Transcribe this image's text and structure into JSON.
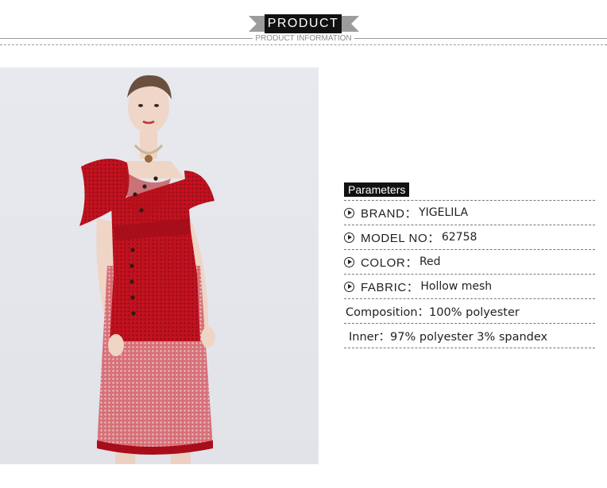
{
  "header": {
    "title": "PRODUCT",
    "subtitle": "PRODUCT INFORMATION"
  },
  "photo": {
    "description_icon": "dress-photo",
    "dress_color": "#c1121f",
    "background_color": "#e4e6eb"
  },
  "parameters": {
    "title": "Parameters",
    "rows": [
      {
        "icon": "arrow-circle-icon",
        "label": "BRAND：",
        "value": "YIGELILA"
      },
      {
        "icon": "arrow-circle-icon",
        "label": "MODEL NO：",
        "value": "62758"
      },
      {
        "icon": "arrow-circle-icon",
        "label": "COLOR：",
        "value": "Red"
      },
      {
        "icon": "arrow-circle-icon",
        "label": "FABRIC：",
        "value": "Hollow mesh"
      }
    ],
    "composition": "Composition：100% polyester",
    "inner": "Inner：97% polyester 3% spandex"
  }
}
